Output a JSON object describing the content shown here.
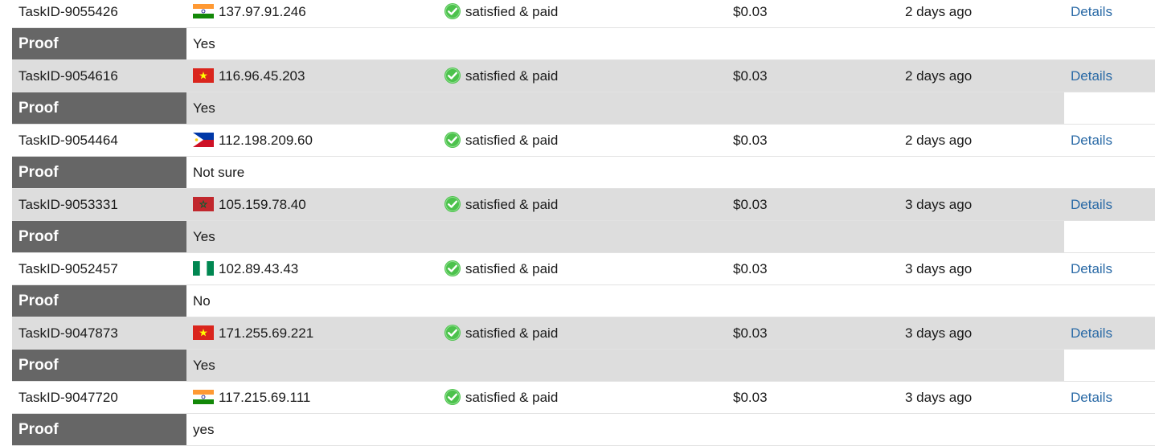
{
  "rows": [
    {
      "task_id": "TaskID-9055426",
      "country": "india-flag-icon",
      "ip": "137.97.91.246",
      "status": "satisfied & paid",
      "price": "$0.03",
      "time": "2 days ago",
      "details": "Details",
      "proof_label": "Proof",
      "proof": "Yes"
    },
    {
      "task_id": "TaskID-9054616",
      "country": "vietnam-flag-icon",
      "ip": "116.96.45.203",
      "status": "satisfied & paid",
      "price": "$0.03",
      "time": "2 days ago",
      "details": "Details",
      "proof_label": "Proof",
      "proof": "Yes"
    },
    {
      "task_id": "TaskID-9054464",
      "country": "philippines-flag-icon",
      "ip": "112.198.209.60",
      "status": "satisfied & paid",
      "price": "$0.03",
      "time": "2 days ago",
      "details": "Details",
      "proof_label": "Proof",
      "proof": "Not sure"
    },
    {
      "task_id": "TaskID-9053331",
      "country": "morocco-flag-icon",
      "ip": "105.159.78.40",
      "status": "satisfied & paid",
      "price": "$0.03",
      "time": "3 days ago",
      "details": "Details",
      "proof_label": "Proof",
      "proof": "Yes"
    },
    {
      "task_id": "TaskID-9052457",
      "country": "nigeria-flag-icon",
      "ip": "102.89.43.43",
      "status": "satisfied & paid",
      "price": "$0.03",
      "time": "3 days ago",
      "details": "Details",
      "proof_label": "Proof",
      "proof": "No"
    },
    {
      "task_id": "TaskID-9047873",
      "country": "vietnam-flag-icon",
      "ip": "171.255.69.221",
      "status": "satisfied & paid",
      "price": "$0.03",
      "time": "3 days ago",
      "details": "Details",
      "proof_label": "Proof",
      "proof": "Yes"
    },
    {
      "task_id": "TaskID-9047720",
      "country": "india-flag-icon",
      "ip": "117.215.69.111",
      "status": "satisfied & paid",
      "price": "$0.03",
      "time": "3 days ago",
      "details": "Details",
      "proof_label": "Proof",
      "proof": "yes"
    }
  ],
  "colors": {
    "link": "#2a6aa6",
    "proof_label_bg": "#666666",
    "alt_row_bg": "#dddddd",
    "check_green": "#4cc24c"
  }
}
